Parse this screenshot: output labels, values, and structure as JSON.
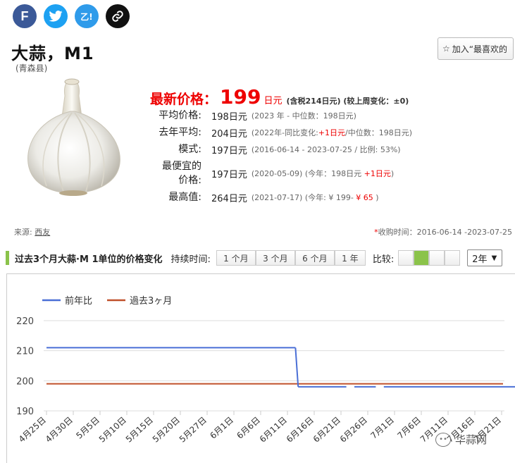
{
  "share": {
    "facebook": "F",
    "other": "乙!"
  },
  "product": {
    "name": "大蒜，M1",
    "location": "(青森县)",
    "fav_label": "加入“最喜欢的"
  },
  "price": {
    "label": "最新价格：",
    "value": "199",
    "unit": "日元",
    "note": "(含税214日元) (较上周变化：±0)"
  },
  "stats": [
    {
      "label": "平均价格:",
      "value": "198日元",
      "note": "(2023 年 - 中位数：198日元)"
    },
    {
      "label": "去年平均:",
      "value": "204日元",
      "note_pre": "(2022年-同比变化:",
      "note_red": "+1日元",
      "note_post": "/中位数：198日元)"
    },
    {
      "label": "模式:",
      "value": "197日元",
      "note": "(2016-06-14 - 2023-07-25 / 比例: 53%)"
    },
    {
      "label": "最便宜的价格:",
      "value": "197日元",
      "note_pre": "(2020-05-09) (今年：198日元 ",
      "note_red": "+1日元",
      "note_post": ")"
    },
    {
      "label": "最高值:",
      "value": "264日元",
      "note_pre": "(2021-07-17) (今年: ¥ 199- ",
      "note_red": "¥ 65",
      "note_post": " )"
    }
  ],
  "source": {
    "label": "来源:",
    "link": "西友"
  },
  "collect_time": "收购时间：2016-06-14 -2023-07-25",
  "section": {
    "title": "过去3个月大蒜·M 1单位的价格变化",
    "duration_label": "持续时间:",
    "durations": [
      "1 个月",
      "3 个月",
      "6 个月",
      "1 年"
    ],
    "compare_label": "比较:",
    "select_value": "2年"
  },
  "chart_data": {
    "type": "line",
    "series": [
      {
        "name": "前年比",
        "color": "#4a6fd6"
      },
      {
        "name": "過去3ヶ月",
        "color": "#c0502a"
      }
    ],
    "yticks": [
      190,
      200,
      210,
      220
    ],
    "ylim": [
      190,
      220
    ],
    "categories": [
      "4月25日",
      "4月30日",
      "5月5日",
      "5月10日",
      "5月15日",
      "5月20日",
      "5月27日",
      "6月1日",
      "6月6日",
      "6月11日",
      "6月16日",
      "6月21日",
      "6月26日",
      "7月1日",
      "7月6日",
      "7月11日",
      "7月16日",
      "7月21日"
    ],
    "segments_prev_year": [
      {
        "from": 0,
        "to": 9.3,
        "y": 211
      },
      {
        "from": 9.3,
        "to": 9.4,
        "y_from": 211,
        "y_to": 198
      },
      {
        "from": 9.4,
        "to": 11.2,
        "y": 198
      },
      {
        "from": 11.5,
        "to": 12.3,
        "y": 198
      },
      {
        "from": 12.6,
        "to": 17.9,
        "y": 198
      }
    ],
    "past_3_months": {
      "y": 199
    }
  },
  "watermark": "华蒜网"
}
